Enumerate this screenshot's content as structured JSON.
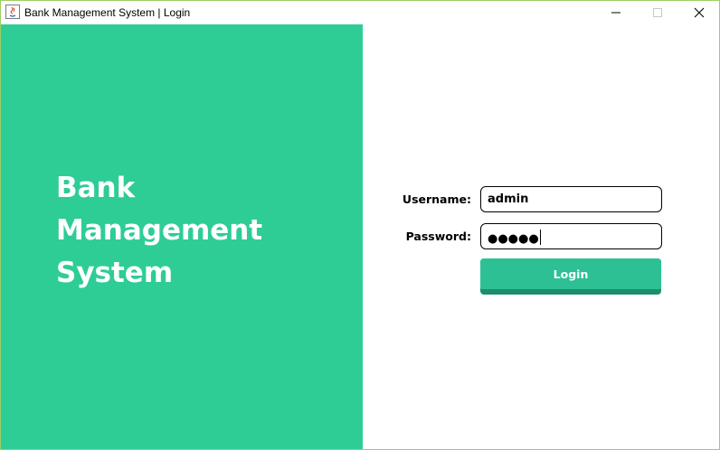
{
  "window": {
    "title": "Bank Management System | Login",
    "controls": {
      "minimize_icon": "minimize-icon",
      "maximize_icon": "maximize-icon",
      "close_icon": "close-icon"
    }
  },
  "branding": {
    "line1": "Bank",
    "line2": "Management",
    "line3": "System",
    "panel_color": "#2ecd96"
  },
  "form": {
    "username_label": "Username:",
    "username_value": "admin",
    "password_label": "Password:",
    "password_masked": "●●●●●",
    "login_label": "Login",
    "button_color": "#2ec095"
  }
}
